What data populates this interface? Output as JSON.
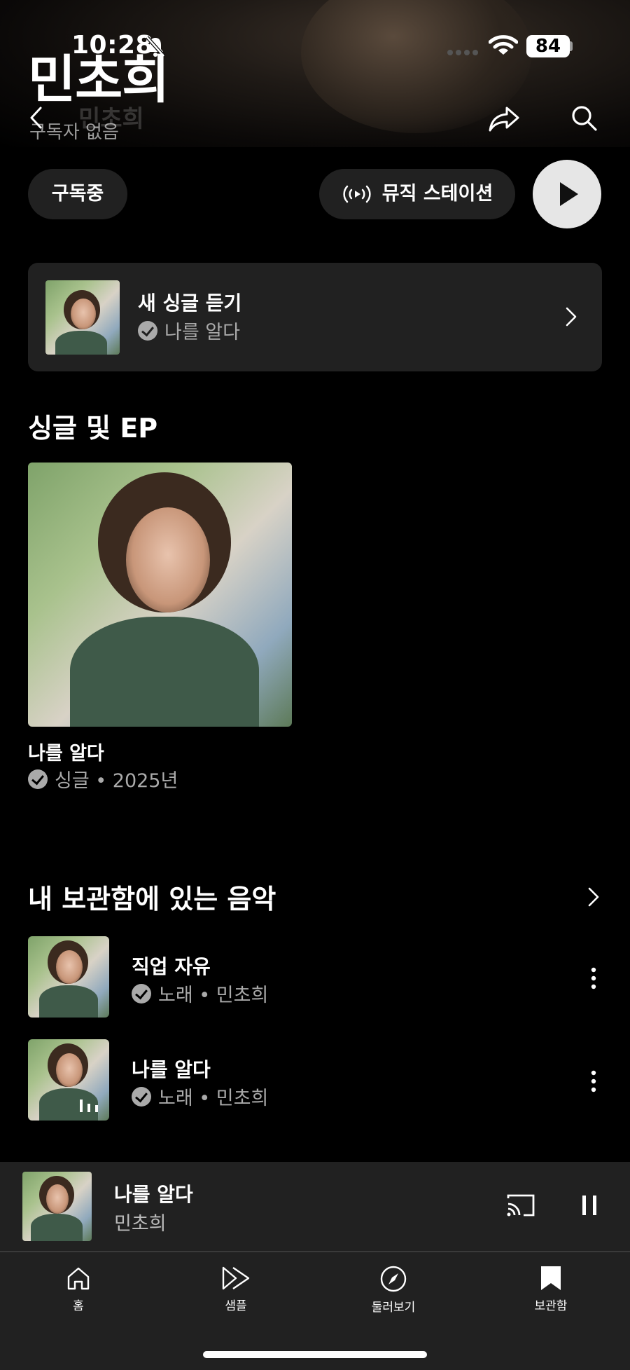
{
  "status_bar": {
    "time": "10:28",
    "battery": "84"
  },
  "header": {
    "artist_name": "민초희",
    "ghost_name": "민초희",
    "subscriber_text": "구독자 없음"
  },
  "actions": {
    "subscribe_label": "구독중",
    "station_label": "뮤직 스테이션"
  },
  "new_single": {
    "title": "새 싱글 듣기",
    "song": "나를 알다"
  },
  "singles": {
    "section_title": "싱글 및 EP",
    "album_title": "나를 알다",
    "album_meta": "싱글 • 2025년"
  },
  "library": {
    "section_title": "내 보관함에 있는 음악",
    "songs": [
      {
        "title": "직업 자유",
        "meta": "노래 • 민초희"
      },
      {
        "title": "나를 알다",
        "meta": "노래 • 민초희"
      }
    ]
  },
  "now_playing": {
    "title": "나를 알다",
    "artist": "민초희"
  },
  "tabs": [
    {
      "label": "홈",
      "icon": "home-icon"
    },
    {
      "label": "샘플",
      "icon": "samples-icon"
    },
    {
      "label": "둘러보기",
      "icon": "explore-icon"
    },
    {
      "label": "보관함",
      "icon": "library-icon"
    }
  ],
  "colors": {
    "background": "#000000",
    "surface": "#212121",
    "secondary_text": "#aaaaaa"
  }
}
